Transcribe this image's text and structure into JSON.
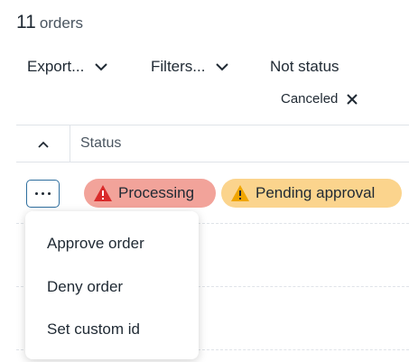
{
  "header": {
    "count": "11",
    "unit": "orders"
  },
  "toolbar": {
    "export_label": "Export...",
    "filters_label": "Filters...",
    "not_status_label": "Not status"
  },
  "filter_chip": {
    "label": "Canceled"
  },
  "table": {
    "status_header": "Status"
  },
  "row1": {
    "badges": [
      {
        "label": "Processing",
        "color": "#f2a39a",
        "icon": "error-triangle-icon"
      },
      {
        "label": "Pending approval",
        "color": "#fbd48d",
        "icon": "warning-triangle-icon"
      }
    ]
  },
  "menu": {
    "items": [
      {
        "label": "Approve order"
      },
      {
        "label": "Deny order"
      },
      {
        "label": "Set custom id"
      }
    ]
  },
  "colors": {
    "accent": "#2e6e9e",
    "error": "#d92b2b",
    "warning": "#f0a500"
  }
}
